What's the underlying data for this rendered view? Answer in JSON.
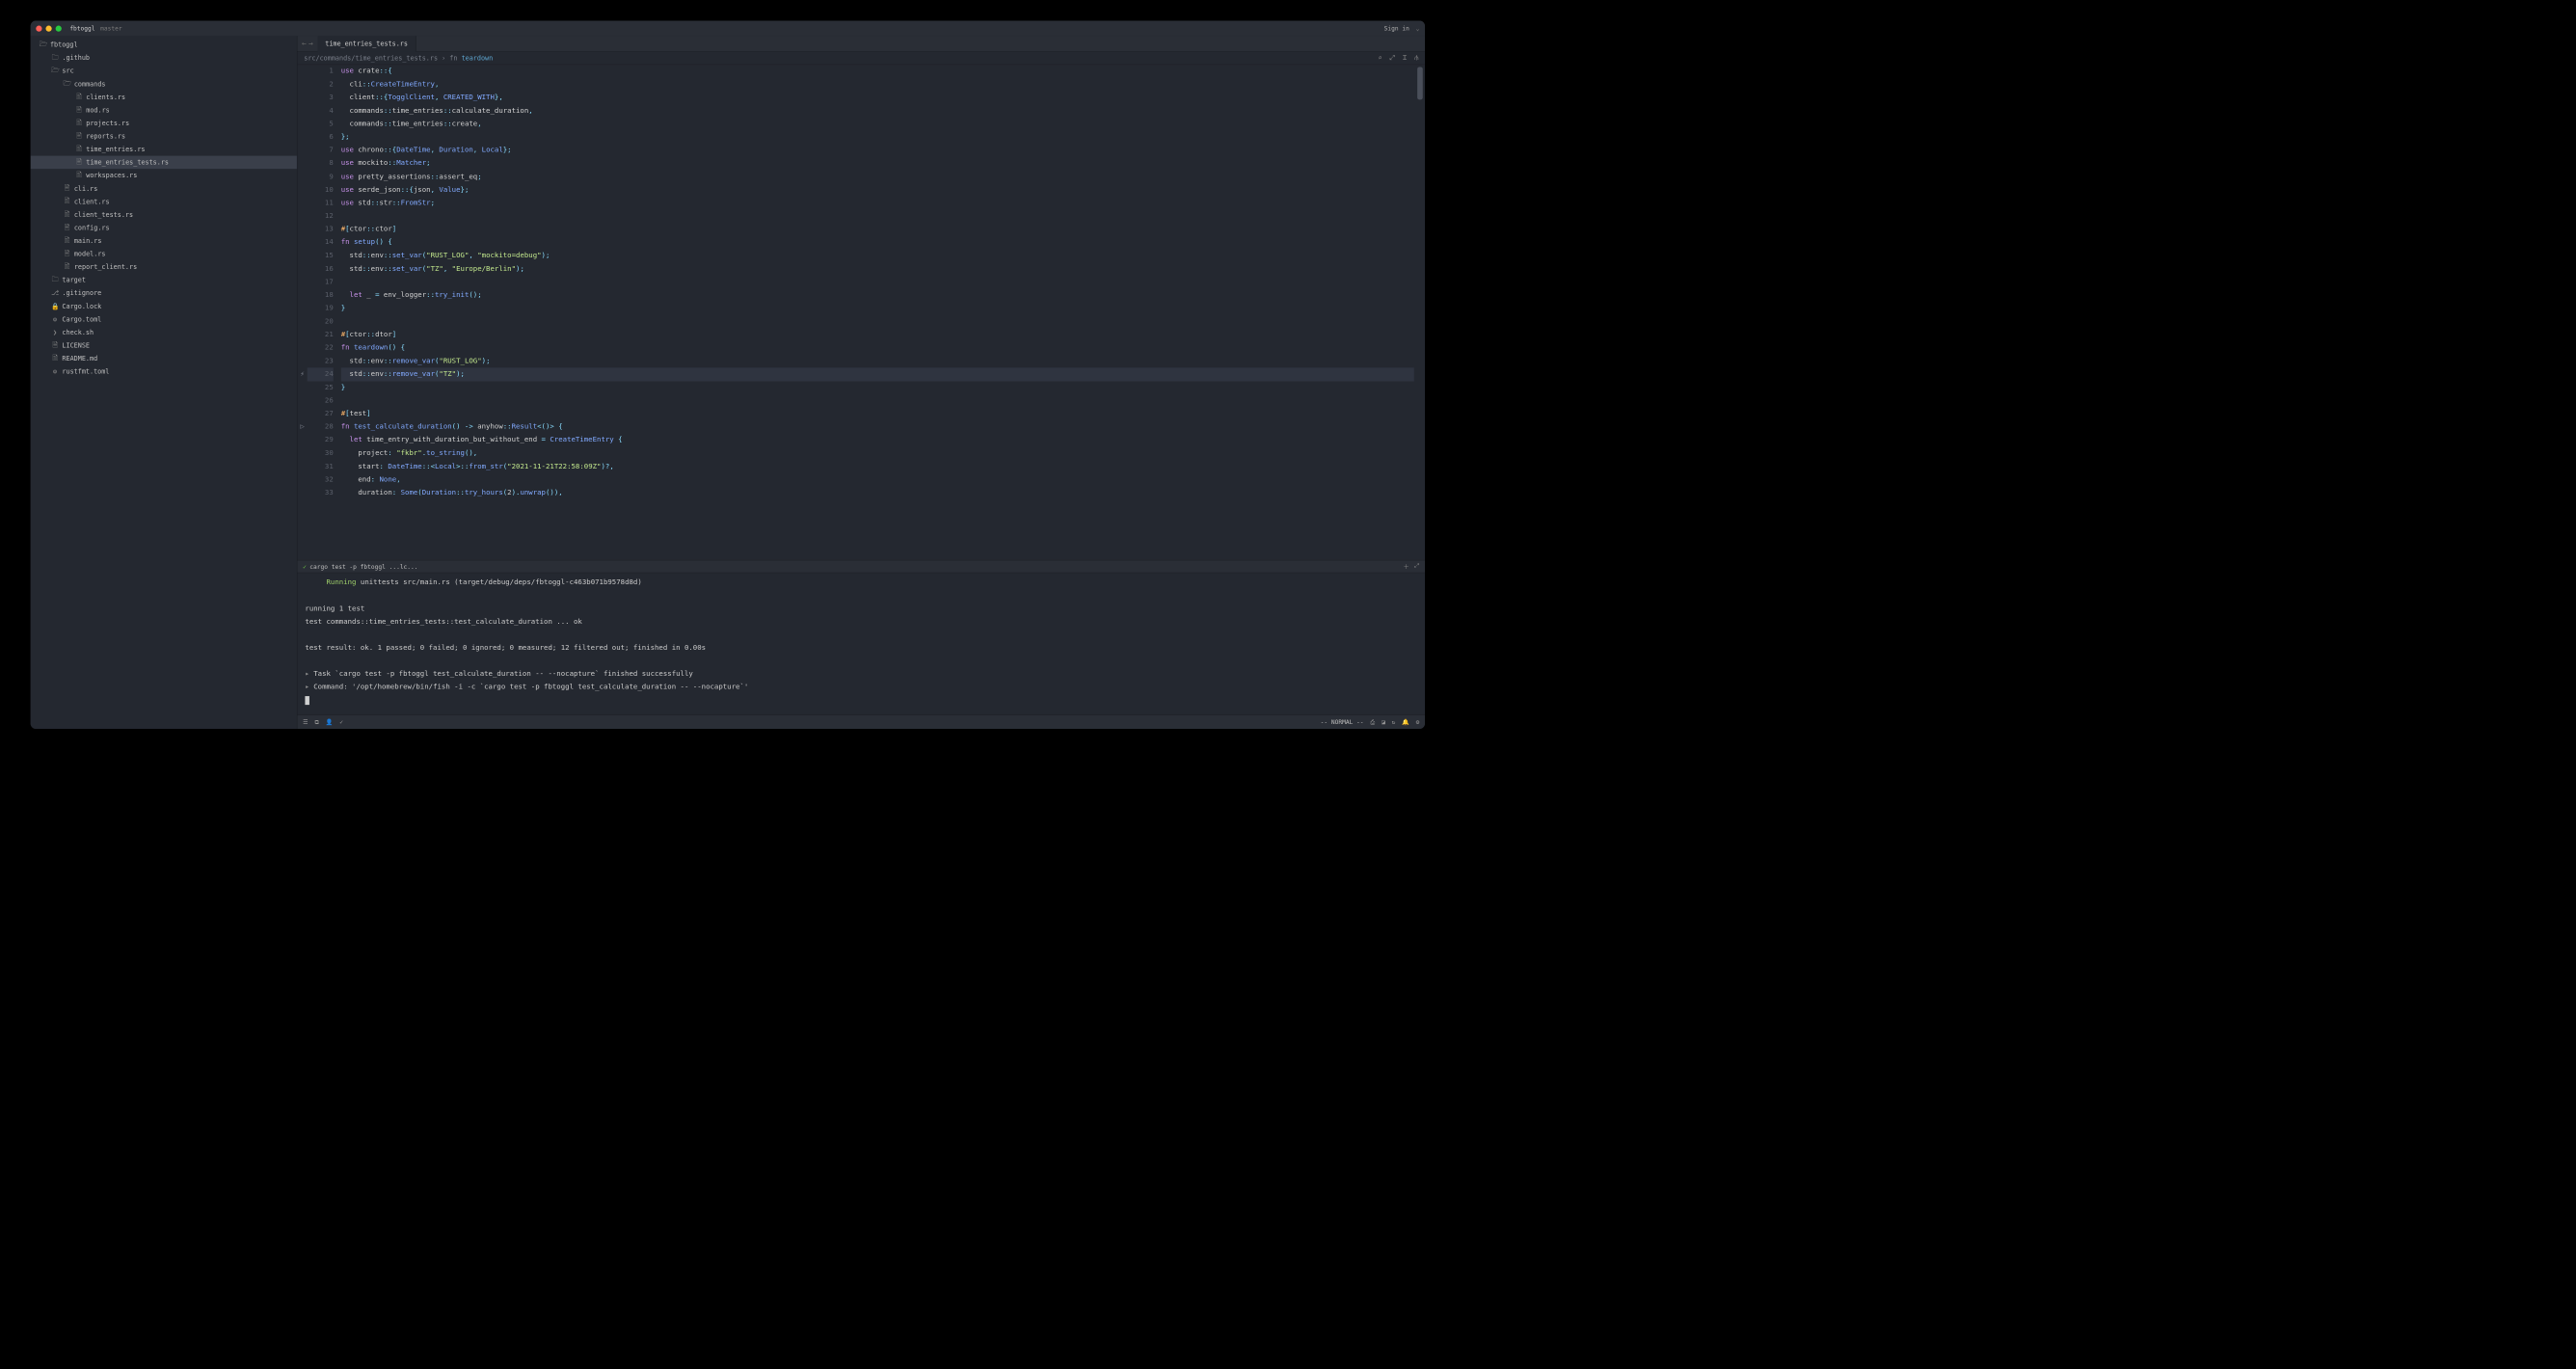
{
  "titlebar": {
    "project": "fbtoggl",
    "branch": "master",
    "signin": "Sign in"
  },
  "sidebar": {
    "items": [
      {
        "depth": 0,
        "icon": "folder-open",
        "label": "fbtoggl"
      },
      {
        "depth": 1,
        "icon": "folder",
        "label": ".github"
      },
      {
        "depth": 1,
        "icon": "folder-open",
        "label": "src"
      },
      {
        "depth": 2,
        "icon": "folder-open",
        "label": "commands"
      },
      {
        "depth": 3,
        "icon": "file",
        "label": "clients.rs"
      },
      {
        "depth": 3,
        "icon": "file",
        "label": "mod.rs"
      },
      {
        "depth": 3,
        "icon": "file",
        "label": "projects.rs"
      },
      {
        "depth": 3,
        "icon": "file",
        "label": "reports.rs"
      },
      {
        "depth": 3,
        "icon": "file",
        "label": "time_entries.rs"
      },
      {
        "depth": 3,
        "icon": "file",
        "label": "time_entries_tests.rs",
        "selected": true
      },
      {
        "depth": 3,
        "icon": "file",
        "label": "workspaces.rs"
      },
      {
        "depth": 2,
        "icon": "file",
        "label": "cli.rs"
      },
      {
        "depth": 2,
        "icon": "file",
        "label": "client.rs"
      },
      {
        "depth": 2,
        "icon": "file",
        "label": "client_tests.rs"
      },
      {
        "depth": 2,
        "icon": "file",
        "label": "config.rs"
      },
      {
        "depth": 2,
        "icon": "file",
        "label": "main.rs"
      },
      {
        "depth": 2,
        "icon": "file",
        "label": "model.rs"
      },
      {
        "depth": 2,
        "icon": "file",
        "label": "report_client.rs"
      },
      {
        "depth": 1,
        "icon": "folder",
        "label": "target"
      },
      {
        "depth": 1,
        "icon": "git",
        "label": ".gitignore"
      },
      {
        "depth": 1,
        "icon": "lock",
        "label": "Cargo.lock"
      },
      {
        "depth": 1,
        "icon": "gear",
        "label": "Cargo.toml"
      },
      {
        "depth": 1,
        "icon": "sh",
        "label": "check.sh"
      },
      {
        "depth": 1,
        "icon": "doc",
        "label": "LICENSE"
      },
      {
        "depth": 1,
        "icon": "md",
        "label": "README.md"
      },
      {
        "depth": 1,
        "icon": "gear",
        "label": "rustfmt.toml"
      }
    ]
  },
  "tabs": {
    "active": "time_entries_tests.rs"
  },
  "breadcrumb": {
    "path": "src/commands/time_entries_tests.rs",
    "fn": "fn",
    "symbol": "teardown"
  },
  "code_lines": [
    {
      "n": 1,
      "html": "<span class='kw'>use</span> <span class='ident'>crate</span><span class='punct'>::{</span>"
    },
    {
      "n": 2,
      "html": "  <span class='ident'>cli</span><span class='punct'>::</span><span class='type'>CreateTimeEntry</span><span class='punct'>,</span>"
    },
    {
      "n": 3,
      "html": "  <span class='ident'>client</span><span class='punct'>::{</span><span class='type'>TogglClient</span><span class='punct'>,</span> <span class='type'>CREATED_WITH</span><span class='punct'>},</span>"
    },
    {
      "n": 4,
      "html": "  <span class='ident'>commands</span><span class='punct'>::</span><span class='ident'>time_entries</span><span class='punct'>::</span><span class='ident'>calculate_duration</span><span class='punct'>,</span>"
    },
    {
      "n": 5,
      "html": "  <span class='ident'>commands</span><span class='punct'>::</span><span class='ident'>time_entries</span><span class='punct'>::</span><span class='ident'>create</span><span class='punct'>,</span>"
    },
    {
      "n": 6,
      "html": "<span class='punct'>};</span>"
    },
    {
      "n": 7,
      "html": "<span class='kw'>use</span> <span class='ident'>chrono</span><span class='punct'>::{</span><span class='type'>DateTime</span><span class='punct'>,</span> <span class='type'>Duration</span><span class='punct'>,</span> <span class='type'>Local</span><span class='punct'>};</span>"
    },
    {
      "n": 8,
      "html": "<span class='kw'>use</span> <span class='ident'>mockito</span><span class='punct'>::</span><span class='type'>Matcher</span><span class='punct'>;</span>"
    },
    {
      "n": 9,
      "html": "<span class='kw'>use</span> <span class='ident'>pretty_assertions</span><span class='punct'>::</span><span class='ident'>assert_eq</span><span class='punct'>;</span>"
    },
    {
      "n": 10,
      "html": "<span class='kw'>use</span> <span class='ident'>serde_json</span><span class='punct'>::{</span><span class='ident'>json</span><span class='punct'>,</span> <span class='type'>Value</span><span class='punct'>};</span>"
    },
    {
      "n": 11,
      "html": "<span class='kw'>use</span> <span class='ident'>std</span><span class='punct'>::</span><span class='ident'>str</span><span class='punct'>::</span><span class='type'>FromStr</span><span class='punct'>;</span>"
    },
    {
      "n": 12,
      "html": ""
    },
    {
      "n": 13,
      "html": "<span class='attr'>#</span><span class='punct'>[</span><span class='ident'>ctor</span><span class='punct'>::</span><span class='ident'>ctor</span><span class='punct'>]</span>"
    },
    {
      "n": 14,
      "html": "<span class='kw'>fn</span> <span class='fn'>setup</span><span class='punct'>() {</span>"
    },
    {
      "n": 15,
      "html": "  <span class='ident'>std</span><span class='punct'>::</span><span class='ident'>env</span><span class='punct'>::</span><span class='fn'>set_var</span><span class='punct'>(</span><span class='str'>\"RUST_LOG\"</span><span class='punct'>,</span> <span class='str'>\"mockito=debug\"</span><span class='punct'>);</span>"
    },
    {
      "n": 16,
      "html": "  <span class='ident'>std</span><span class='punct'>::</span><span class='ident'>env</span><span class='punct'>::</span><span class='fn'>set_var</span><span class='punct'>(</span><span class='str'>\"TZ\"</span><span class='punct'>,</span> <span class='str'>\"Europe/Berlin\"</span><span class='punct'>);</span>"
    },
    {
      "n": 17,
      "html": ""
    },
    {
      "n": 18,
      "html": "  <span class='kw'>let</span> <span class='ident'>_</span> <span class='op'>=</span> <span class='ident'>env_logger</span><span class='punct'>::</span><span class='fn'>try_init</span><span class='punct'>();</span>"
    },
    {
      "n": 19,
      "html": "<span class='punct'>}</span>"
    },
    {
      "n": 20,
      "html": ""
    },
    {
      "n": 21,
      "html": "<span class='attr'>#</span><span class='punct'>[</span><span class='ident'>ctor</span><span class='punct'>::</span><span class='ident'>dtor</span><span class='punct'>]</span>"
    },
    {
      "n": 22,
      "html": "<span class='kw'>fn</span> <span class='fn'>teardown</span><span class='punct'>() {</span>"
    },
    {
      "n": 23,
      "html": "  <span class='ident'>std</span><span class='punct'>::</span><span class='ident'>env</span><span class='punct'>::</span><span class='fn'>remove_var</span><span class='punct'>(</span><span class='str'>\"RUST_LOG\"</span><span class='punct'>);</span>"
    },
    {
      "n": 24,
      "hl": true,
      "gut": "⚡",
      "html": "  <span class='ident'>std</span><span class='punct'>::</span><span class='ident'>env</span><span class='punct'>::</span><span class='fn'>remove_var</span><span class='punct'>(</span><span class='str'>\"TZ\"</span><span class='punct'>);</span>"
    },
    {
      "n": 25,
      "html": "<span class='punct'>}</span>"
    },
    {
      "n": 26,
      "html": ""
    },
    {
      "n": 27,
      "html": "<span class='attr'>#</span><span class='punct'>[</span><span class='ident'>test</span><span class='punct'>]</span>"
    },
    {
      "n": 28,
      "gut": "▷",
      "html": "<span class='kw'>fn</span> <span class='fn'>test_calculate_duration</span><span class='punct'>()</span> <span class='op'>-&gt;</span> <span class='ident'>anyhow</span><span class='punct'>::</span><span class='type'>Result</span><span class='punct'>&lt;()&gt; {</span>"
    },
    {
      "n": 29,
      "html": "  <span class='kw'>let</span> <span class='ident'>time_entry_with_duration_but_without_end</span> <span class='op'>=</span> <span class='type'>CreateTimeEntry</span> <span class='punct'>{</span>"
    },
    {
      "n": 30,
      "html": "    <span class='ident'>project</span><span class='punct'>:</span> <span class='str'>\"fkbr\"</span><span class='punct'>.</span><span class='fn'>to_string</span><span class='punct'>(),</span>"
    },
    {
      "n": 31,
      "html": "    <span class='ident'>start</span><span class='punct'>:</span> <span class='type'>DateTime</span><span class='punct'>::&lt;</span><span class='type'>Local</span><span class='punct'>&gt;::</span><span class='fn'>from_str</span><span class='punct'>(</span><span class='str'>\"2021-11-21T22:58:09Z\"</span><span class='punct'>)?,</span>"
    },
    {
      "n": 32,
      "html": "    <span class='ident'>end</span><span class='punct'>:</span> <span class='type'>None</span><span class='punct'>,</span>"
    },
    {
      "n": 33,
      "html": "    <span class='ident'>duration</span><span class='punct'>:</span> <span class='type'>Some</span><span class='punct'>(</span><span class='type'>Duration</span><span class='punct'>::</span><span class='fn'>try_hours</span><span class='punct'>(</span><span class='ident'>2</span><span class='punct'>).</span><span class='fn'>unwrap</span><span class='punct'>()),</span>"
    }
  ],
  "terminal": {
    "title": "cargo test -p fbtoggl ...lc...",
    "lines": [
      {
        "cls": "term-green",
        "pad": "     ",
        "text": "Running",
        "rest": " unittests src/main.rs (target/debug/deps/fbtoggl-c463b071b9578d8d)"
      },
      {
        "text": ""
      },
      {
        "text": "running 1 test"
      },
      {
        "text": "test commands::time_entries_tests::test_calculate_duration ... ok"
      },
      {
        "text": ""
      },
      {
        "text": "test result: ok. 1 passed; 0 failed; 0 ignored; 0 measured; 12 filtered out; finished in 0.00s"
      },
      {
        "text": ""
      },
      {
        "arrow": true,
        "text": "Task `cargo test -p fbtoggl test_calculate_duration -- --nocapture` finished successfully"
      },
      {
        "arrow": true,
        "text": "Command: '/opt/homebrew/bin/fish -i -c `cargo test -p fbtoggl test_calculate_duration -- --nocapture`'"
      }
    ]
  },
  "statusbar": {
    "mode": "-- NORMAL --"
  },
  "icons": {
    "folder": "▸ 🖿",
    "folder-open": "▾ 🖿",
    "file": "⌖",
    "git": "⎇",
    "lock": "🔒",
    "gear": "⚙",
    "sh": "❯",
    "doc": "🗎",
    "md": "🗎"
  }
}
